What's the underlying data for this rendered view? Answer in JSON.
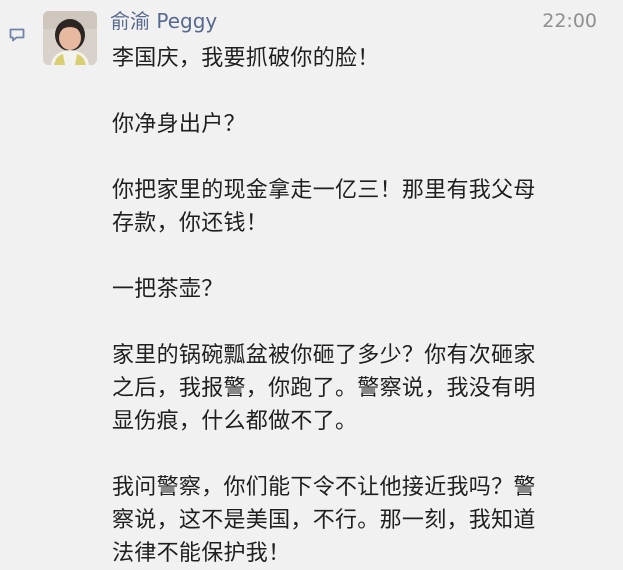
{
  "message": {
    "sender": "俞渝 Peggy",
    "time": "22:00",
    "paragraphs": [
      "李国庆，我要抓破你的脸！",
      "你净身出户？",
      "你把家里的现金拿走一亿三！那里有我父母\n存款，你还钱！",
      "一把茶壶？",
      "家里的锅碗瓢盆被你砸了多少？你有次砸家\n之后，我报警，你跑了。警察说，我没有明\n显伤痕，什么都做不了。",
      "我问警察，你们能下令不让他接近我吗？警\n察说，这不是美国，不行。那一刻，我知道\n法律不能保护我！"
    ]
  },
  "icons": {
    "message": "comment-icon",
    "avatar": "avatar"
  },
  "colors": {
    "background": "#f1f1f1",
    "sender": "#57698f",
    "time": "#8f8f8f",
    "text": "#1f1f1f",
    "icon": "#6f84a8"
  }
}
